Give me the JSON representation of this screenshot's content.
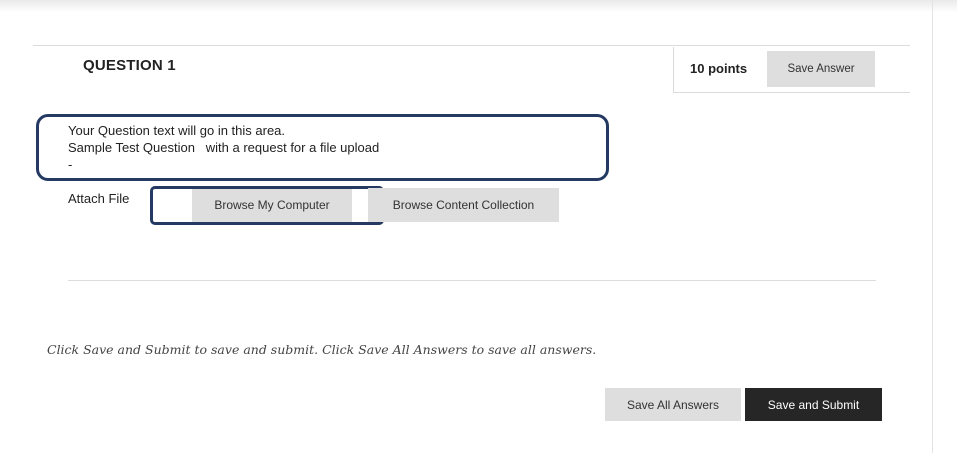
{
  "question": {
    "title": "QUESTION 1",
    "points": "10 points",
    "save_answer_label": "Save Answer",
    "text_lines": [
      "Your Question text will go in this area.",
      "Sample Test Question   with a request for a file upload",
      "-"
    ]
  },
  "attach": {
    "label": "Attach File",
    "browse_computer_label": "Browse My Computer",
    "browse_collection_label": "Browse Content Collection"
  },
  "footer": {
    "instructions": "Click Save and Submit to save and submit. Click Save All Answers to save all answers.",
    "save_all_label": "Save All Answers",
    "save_submit_label": "Save and Submit"
  },
  "colors": {
    "highlight_outline": "#243a63",
    "primary_button": "#262626",
    "secondary_button": "#dedede"
  }
}
